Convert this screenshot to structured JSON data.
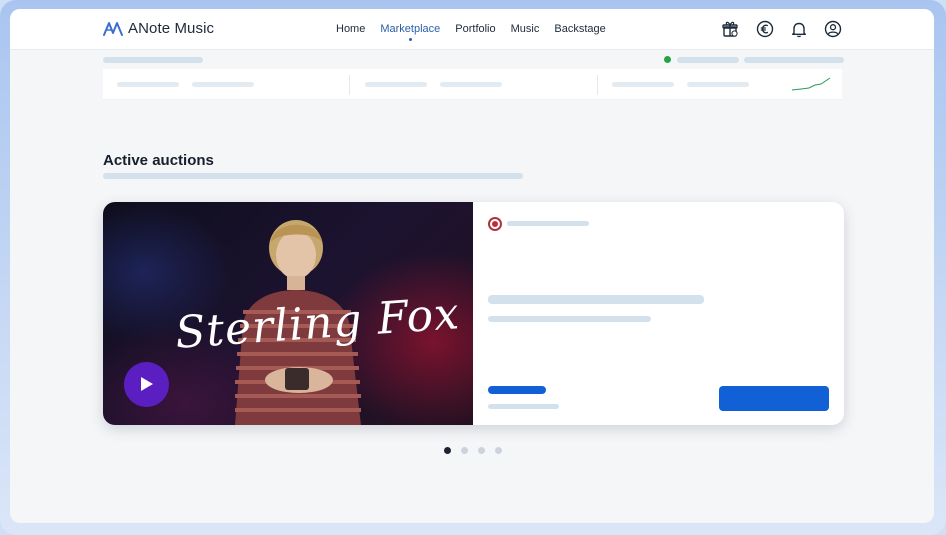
{
  "app": {
    "name": "ANote Music"
  },
  "nav": {
    "items": [
      {
        "label": "Home",
        "active": false
      },
      {
        "label": "Marketplace",
        "active": true
      },
      {
        "label": "Portfolio",
        "active": false
      },
      {
        "label": "Music",
        "active": false
      },
      {
        "label": "Backstage",
        "active": false
      }
    ]
  },
  "header_icons": [
    "gift-icon",
    "euro-icon",
    "bell-icon",
    "user-icon"
  ],
  "main": {
    "section_title": "Active auctions"
  },
  "auction_card": {
    "image_title": "Sterling Fox",
    "status_color": "#b3323a"
  },
  "carousel": {
    "page_count": 4,
    "active_index": 0
  },
  "colors": {
    "accent": "#1160d6",
    "nav_active": "#2a5fa8",
    "status_green": "#25a34a",
    "play_button": "#5a1ec1"
  }
}
